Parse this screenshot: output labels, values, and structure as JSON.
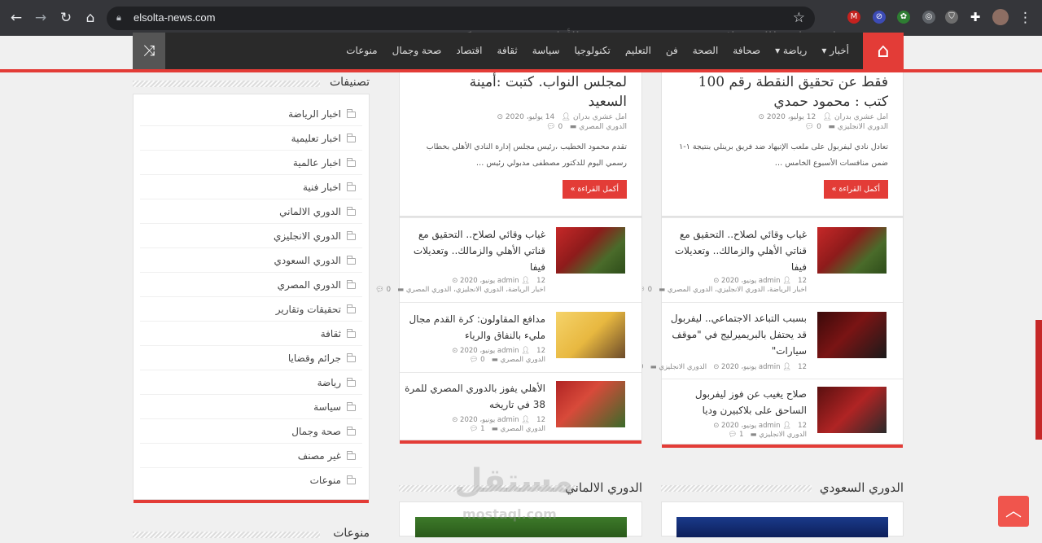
{
  "browser": {
    "url": "elsolta-news.com",
    "colors": {
      "toolbar": "#35363a",
      "omnibox": "#202124"
    }
  },
  "nav": {
    "items": [
      "أخبار",
      "رياضة",
      "صحافة",
      "الصحة",
      "فن",
      "التعليم",
      "تكنولوجيا",
      "سياسة",
      "ثقافة",
      "اقتصاد",
      "صحة وجمال",
      "منوعات"
    ],
    "accent": "#e33c37"
  },
  "ghost": {
    "left": "الأهلي ينعى رفع تمكوي ضد",
    "right": "ليفربول يطالب فيلا بتغيير"
  },
  "featured": [
    {
      "title_line1": "فقط عن تحقيق النقطة رقم 100",
      "title_line2": "كتب : محمود حمدي",
      "author": "امل عشري بدران",
      "date": "12 يوليو، 2020",
      "category": "الدوري الانجليزي",
      "comments": "0",
      "excerpt": "تعادل نادي ليفربول على ملعب الإتيهاد ضد فريق برينلي بنتيجة ١-١ ضمن منافسات الأسبوع الخامس …",
      "read_more": "أكمل القراءة »"
    },
    {
      "title_line1": "لمجلس النواب. كتبت :أمينة",
      "title_line2": "السعيد",
      "author": "امل عشري بدران",
      "date": "14 يوليو، 2020",
      "category": "الدوري المصري",
      "comments": "0",
      "excerpt": "تقدم محمود الخطيب ،رئيس مجلس إدارة النادي الأهلي بخطاب رسمي اليوم للدكتور مصطفى مدبولي رئيس …",
      "read_more": "أكمل القراءة »"
    }
  ],
  "right_list": [
    {
      "title": "غياب وقائي لصلاح.. التحقيق مع قناتي الأهلي والزمالك.. وتعديلات فيفا",
      "author": "admin",
      "date": "12 يونيو، 2020",
      "category": "اخبار الرياضة، الدوري الانجليزي، الدوري المصري",
      "comments": "0"
    },
    {
      "title": "بسبب التباعد الاجتماعي.. ليفربول قد يحتفل بالبريميرليج في \"موقف سيارات\"",
      "author": "admin",
      "date": "12 يونيو، 2020",
      "category": "الدوري الانجليزي",
      "comments": "0"
    },
    {
      "title": "صلاح يغيب عن فوز ليفربول الساحق على بلاكبيرن وديا",
      "author": "admin",
      "date": "12 يونيو، 2020",
      "category": "الدوري الانجليزي",
      "comments": "1"
    }
  ],
  "left_list": [
    {
      "title": "غياب وقائي لصلاح.. التحقيق مع قناتي الأهلي والزمالك.. وتعديلات فيفا",
      "author": "admin",
      "date": "12 يونيو، 2020",
      "category": "اخبار الرياضة، الدوري الانجليزي، الدوري المصري",
      "comments": "0"
    },
    {
      "title": "مدافع المقاولون: كرة القدم مجال مليء بالنفاق والرياء",
      "author": "admin",
      "date": "12 يونيو، 2020",
      "category": "الدوري المصري",
      "comments": "0"
    },
    {
      "title": "الأهلي يفوز بالدوري المصري للمرة 38 في تاريخه",
      "author": "admin",
      "date": "12 يونيو، 2020",
      "category": "الدوري المصري",
      "comments": "1"
    }
  ],
  "sidebar": {
    "title": "تصنيفات",
    "categories": [
      "اخبار الرياضة",
      "اخبار تعليمية",
      "اخبار عالمية",
      "اخبار فنية",
      "الدوري الالماني",
      "الدوري الانجليزي",
      "الدوري السعودي",
      "الدوري المصري",
      "تحقيقات وتقارير",
      "ثقافة",
      "جرائم وقضايا",
      "رياضة",
      "سياسة",
      "صحة وجمال",
      "غير مصنف",
      "منوعات"
    ],
    "next_title": "منوعات"
  },
  "sections": {
    "saudi": "الدوري السعودي",
    "german": "الدوري الالماني"
  },
  "watermark": {
    "ar": "مستقل",
    "en": "mostaql.com"
  }
}
